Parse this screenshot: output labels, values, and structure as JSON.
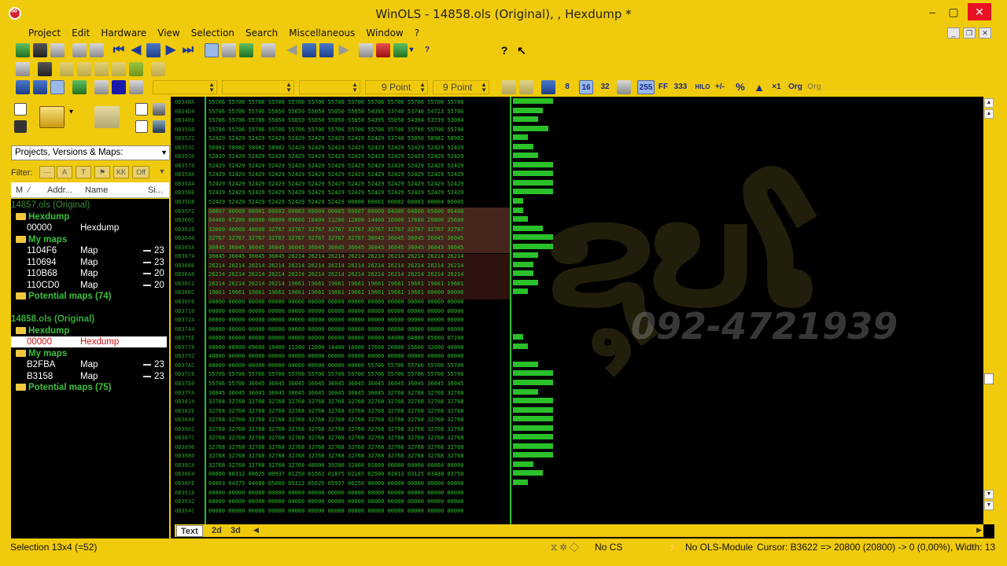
{
  "window": {
    "title": "WinOLS - 14858.ols (Original), , Hexdump *",
    "minimize": "–",
    "maximize": "▢",
    "close": "✕"
  },
  "menu": [
    "Project",
    "Edit",
    "Hardware",
    "View",
    "Selection",
    "Search",
    "Miscellaneous",
    "Window",
    "?"
  ],
  "toolbar": {
    "font_size_1": "9 Point",
    "font_size_2": "9 Point",
    "btn_8": "8",
    "btn_16": "16",
    "btn_32": "32",
    "btn_255": "255",
    "btn_ff": "FF",
    "btn_333": "333",
    "btn_hilo": "HILO",
    "btn_percent": "%",
    "btn_x1": "×1",
    "btn_org": "Org",
    "btn_org2": "Org",
    "help": "?"
  },
  "left_panel": {
    "combo": "Projects, Versions & Maps:",
    "filter_label": "Filter:",
    "filter_off": "Off",
    "columns": {
      "m": "M",
      "addr": "Addr...",
      "name": "Name",
      "size": "Si..."
    },
    "tree": [
      {
        "type": "project",
        "c1": "14857.ols (Original)",
        "dim": true
      },
      {
        "type": "folder",
        "c1": "Hexdump"
      },
      {
        "type": "item",
        "c1": "00000",
        "c2": "Hexdump",
        "c3": ""
      },
      {
        "type": "folder",
        "c1": "My maps"
      },
      {
        "type": "item",
        "c1": "1104F6",
        "c2": "Map",
        "c3": "23"
      },
      {
        "type": "item",
        "c1": "110694",
        "c2": "Map",
        "c3": "23"
      },
      {
        "type": "item",
        "c1": "110B68",
        "c2": "Map",
        "c3": "20"
      },
      {
        "type": "item",
        "c1": "110CD0",
        "c2": "Map",
        "c3": "20"
      },
      {
        "type": "folder",
        "c1": "Potential maps (74)"
      },
      {
        "type": "spacer",
        "c1": ""
      },
      {
        "type": "project",
        "c1": "14858.ols (Original)"
      },
      {
        "type": "folder",
        "c1": "Hexdump"
      },
      {
        "type": "selected",
        "c1": "00000",
        "c2": "Hexdump",
        "c3": ""
      },
      {
        "type": "folder",
        "c1": "My maps"
      },
      {
        "type": "item",
        "c1": "B2FBA",
        "c2": "Map",
        "c3": "23"
      },
      {
        "type": "item",
        "c1": "B3158",
        "c2": "Map",
        "c3": "23"
      },
      {
        "type": "folder",
        "c1": "Potential maps (75)"
      }
    ]
  },
  "hexdump": {
    "addresses": [
      "0B34BA",
      "0B34D4",
      "0B34EE",
      "0B3508",
      "0B3522",
      "0B353C",
      "0B3556",
      "0B3570",
      "0B358A",
      "0B35A4",
      "0B35BE",
      "0B35D8",
      "0B35F2",
      "0B360C",
      "0B3626",
      "0B3640",
      "0B365A",
      "0B3674",
      "0B368E",
      "0B36A8",
      "0B36C2",
      "0B36DC",
      "0B36F6",
      "0B3710",
      "0B372A",
      "0B3744",
      "0B375E",
      "0B3778",
      "0B3792",
      "0B37AC",
      "0B37C6",
      "0B37E0",
      "0B37FA",
      "0B3814",
      "0B382E",
      "0B3848",
      "0B3862",
      "0B387C",
      "0B3896",
      "0B38B0",
      "0B38CA",
      "0B38E4",
      "0B38FE",
      "0B3918",
      "0B3932",
      "0B394C"
    ],
    "rows": [
      "55706 55706 55706 55706 55706 55706 55706 55706 55706 55706 55706 55706 55706",
      "55706 55706 55706 55050 55050 55050 55050 55050 54395 53740 53740 54723 55706",
      "55706 55706 55706 55050 55050 55050 55050 55050 54395 55050 54394 53739 53084",
      "55706 55706 55706 55706 55706 55706 55706 55706 55706 55706 55706 55706 55706",
      "52429 52429 52429 52429 52429 52429 52429 52429 52429 53740 55050 58982 58982",
      "58982 58982 58982 58982 52429 52429 52429 52429 52429 52429 52429 52429 52429",
      "52429 52429 52429 52429 52429 52429 52429 52429 52429 52429 52429 52429 52429",
      "52429 52429 52429 52429 52429 52429 52429 52429 52429 52429 52429 52429 52429",
      "52429 52429 52429 52429 52429 52429 52429 52429 52429 52429 52429 52429 52429",
      "52429 52429 52429 52429 52429 52429 52429 52429 52429 52429 52429 52429 52429",
      "52429 52429 52429 52429 52429 52429 52429 52429 52429 52429 52429 52429 52429",
      "52429 52429 52429 52429 52429 52429 52429 00000 00001 00002 00003 00004 00005",
      "00007 00000 00001 00002 00003 00004 00005 00007 00000 04000 04800 05600 06400",
      "04400 07200 08000 08800 09600 10400 11200 12800 14400 16000 17600 20800 25600",
      "32000 40000 48000 32767 32767 32767 32767 32767 32767 32767 32767 32767 32767",
      "32767 32767 32767 32767 32767 32767 32767 32767 36045 36045 36045 36045 36045",
      "36045 36045 36045 36045 36045 36045 36045 36045 36045 36045 36045 36045 36045",
      "36045 36045 36045 36045 26214 26214 26214 26214 26214 26214 26214 26214 26214",
      "26214 26214 26214 26214 26214 26214 26214 26214 26214 26214 26214 26214 26214",
      "26214 26214 26214 26214 26214 26214 26214 26214 26214 26214 26214 26214 26214",
      "26214 26214 26214 26214 19661 19661 19661 19661 19661 19661 19661 19661 19661",
      "19661 19661 19661 19661 19661 19661 19661 19661 19661 19661 19661 00000 00000",
      "00000 00000 00000 00000 00000 00000 00000 00000 00000 00000 00000 00000 00000",
      "00000 00000 00000 00000 00000 00000 00000 00000 00000 00000 00000 00000 00000",
      "00000 00000 00000 00000 00000 00000 00000 00000 00000 00000 00000 00000 00000",
      "00000 00000 00000 00000 00000 00000 00000 00000 00000 00000 00000 00000 00000",
      "00000 00000 00000 00000 00000 00000 00000 00000 00000 04000 04800 05600 07200",
      "08000 08800 09600 10400 11200 12800 14400 16000 17600 20800 25600 32000 40000",
      "48000 00000 00000 00000 00000 00000 00000 00000 00000 00000 00000 00000 00000",
      "00000 00000 00000 00000 00000 00000 00000 00000 55706 55706 55706 55706 55706",
      "55706 55706 55706 55706 55706 55706 55706 55706 55706 55706 55706 55706 55706",
      "55706 55706 36045 36045 36045 36045 36045 36045 36045 36045 36045 36045 36045",
      "36045 36045 36045 36045 36045 36045 36045 36045 36045 32768 32768 32768 32768",
      "32768 32768 32768 32768 32768 32768 32768 32768 32768 32768 32768 32768 32768",
      "32768 32768 32768 32768 32768 32768 32768 32768 32768 32768 32768 32768 32768",
      "32768 32768 32768 32768 32768 32768 32768 32768 32768 32768 32768 32768 32768",
      "32768 32768 32768 32768 32768 32768 32768 32768 32768 32768 32768 32768 32768",
      "32768 32768 32768 32768 32768 32768 32768 32768 32768 32768 32768 32768 32768",
      "32768 32768 32768 32768 32768 32768 32768 32768 32768 32768 32768 32768 32768",
      "32768 32768 32768 32768 32768 32768 32768 32768 32768 32768 32768 32768 32768",
      "32768 32768 32768 32768 32768 40000 39200 32400 01600 00000 00000 00064 00000",
      "00000 00312 00625 00937 01250 01562 01875 02187 02500 02813 03125 03438 03750",
      "04063 04375 04688 05000 05312 05625 05937 06250 00000 00000 00000 00000 00000",
      "00000 00000 00000 00000 00000 00000 00000 00000 00000 00000 00000 00000 00000",
      "00000 00000 00000 00000 00000 00000 00000 00000 00000 00000 00000 00000 00000",
      "00000 00000 00000 00000 00000 00000 00000 00000 00000 00000 00000 00000 00000"
    ],
    "bar_levels": [
      0.8,
      0.6,
      0.5,
      0.7,
      0.3,
      0.4,
      0.5,
      0.8,
      0.8,
      0.8,
      0.8,
      0.2,
      0.2,
      0.3,
      0.6,
      0.8,
      0.8,
      0.5,
      0.4,
      0.4,
      0.5,
      0.3,
      0,
      0,
      0,
      0,
      0.2,
      0.3,
      0,
      0.5,
      0.8,
      0.8,
      0.5,
      0.8,
      0.8,
      0.8,
      0.8,
      0.8,
      0.8,
      0.8,
      0.4,
      0.6,
      0.3,
      0,
      0,
      0
    ]
  },
  "watermark": {
    "phone": "092-4721939"
  },
  "tabs": {
    "text": "Text",
    "t2d": "2d",
    "t3d": "3d"
  },
  "statusbar": {
    "selection": "Selection 13x4 (=52)",
    "cs": "No CS",
    "module": "No OLS-Module",
    "cursor": "Cursor: B3622 => 20800 (20800) -> 0 (0,00%), Width: 13"
  }
}
